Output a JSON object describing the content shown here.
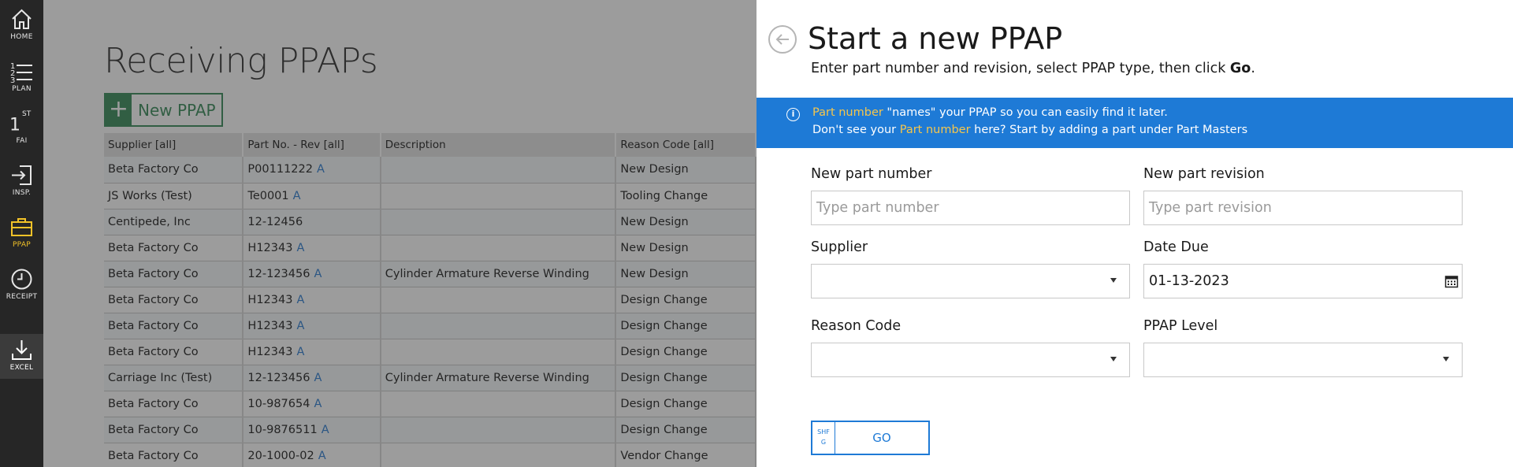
{
  "nav": {
    "items": [
      {
        "label": "HOME",
        "icon": "home-icon"
      },
      {
        "label": "PLAN",
        "icon": "list-icon"
      },
      {
        "label": "FAI",
        "icon": "first-article-icon",
        "glyph": "1",
        "sup": "ST"
      },
      {
        "label": "INSP.",
        "icon": "inspection-icon"
      },
      {
        "label": "PPAP",
        "icon": "briefcase-icon",
        "active": true
      },
      {
        "label": "RECEIPT",
        "icon": "clock-icon"
      },
      {
        "label": "EXCEL",
        "icon": "download-icon"
      }
    ],
    "active_color": "#f2c228"
  },
  "page": {
    "title": "Receiving PPAPs",
    "new_button": {
      "icon": "+",
      "label": "New PPAP"
    },
    "columns": [
      "Supplier [all]",
      "Part No. - Rev [all]",
      "Description",
      "Reason Code [all]"
    ],
    "rows": [
      {
        "supplier": "Beta Factory Co",
        "part": "P00111222",
        "rev": "A",
        "description": "",
        "reason": "New Design"
      },
      {
        "supplier": "JS Works (Test)",
        "part": "Te0001",
        "rev": "A",
        "description": "",
        "reason": "Tooling Change"
      },
      {
        "supplier": "Centipede, Inc",
        "part": "12-12456",
        "rev": "",
        "description": "",
        "reason": "New Design"
      },
      {
        "supplier": "Beta Factory Co",
        "part": "H12343",
        "rev": "A",
        "description": "",
        "reason": "New Design"
      },
      {
        "supplier": "Beta Factory Co",
        "part": "12-123456",
        "rev": "A",
        "description": "Cylinder Armature Reverse Winding",
        "reason": "New Design"
      },
      {
        "supplier": "Beta Factory Co",
        "part": "H12343",
        "rev": "A",
        "description": "",
        "reason": "Design Change"
      },
      {
        "supplier": "Beta Factory Co",
        "part": "H12343",
        "rev": "A",
        "description": "",
        "reason": "Design Change"
      },
      {
        "supplier": "Beta Factory Co",
        "part": "H12343",
        "rev": "A",
        "description": "",
        "reason": "Design Change"
      },
      {
        "supplier": "Carriage Inc (Test)",
        "part": "12-123456",
        "rev": "A",
        "description": "Cylinder Armature Reverse Winding",
        "reason": "Design Change"
      },
      {
        "supplier": "Beta Factory Co",
        "part": "10-987654",
        "rev": "A",
        "description": "",
        "reason": "Design Change"
      },
      {
        "supplier": "Beta Factory Co",
        "part": "10-9876511",
        "rev": "A",
        "description": "",
        "reason": "Design Change"
      },
      {
        "supplier": "Beta Factory Co",
        "part": "20-1000-02",
        "rev": "A",
        "description": "",
        "reason": "Vendor Change"
      }
    ],
    "accent_color": "#3a8c5c"
  },
  "panel": {
    "title": "Start a new PPAP",
    "subtitle_prefix": "Enter part number and revision, select PPAP type, then click ",
    "subtitle_bold": "Go",
    "subtitle_suffix": ".",
    "banner": {
      "line1_hl": "Part number",
      "line1_rest": " \"names\" your PPAP so you can easily find it later.",
      "line2_prefix": "Don't see your ",
      "line2_hl": "Part number",
      "line2_suffix": " here? Start by adding a part under Part Masters",
      "color": "#1e7ad6"
    },
    "fields": {
      "part_number": {
        "label": "New part number",
        "placeholder": "Type part number"
      },
      "part_revision": {
        "label": "New part revision",
        "placeholder": "Type part revision"
      },
      "supplier": {
        "label": "Supplier",
        "value": ""
      },
      "date_due": {
        "label": "Date Due",
        "value": "01-13-2023"
      },
      "reason_code": {
        "label": "Reason Code",
        "value": ""
      },
      "ppap_level": {
        "label": "PPAP Level",
        "value": ""
      }
    },
    "go_button": {
      "shortcut_line1": "SHF",
      "shortcut_line2": "G",
      "label": "GO"
    }
  }
}
